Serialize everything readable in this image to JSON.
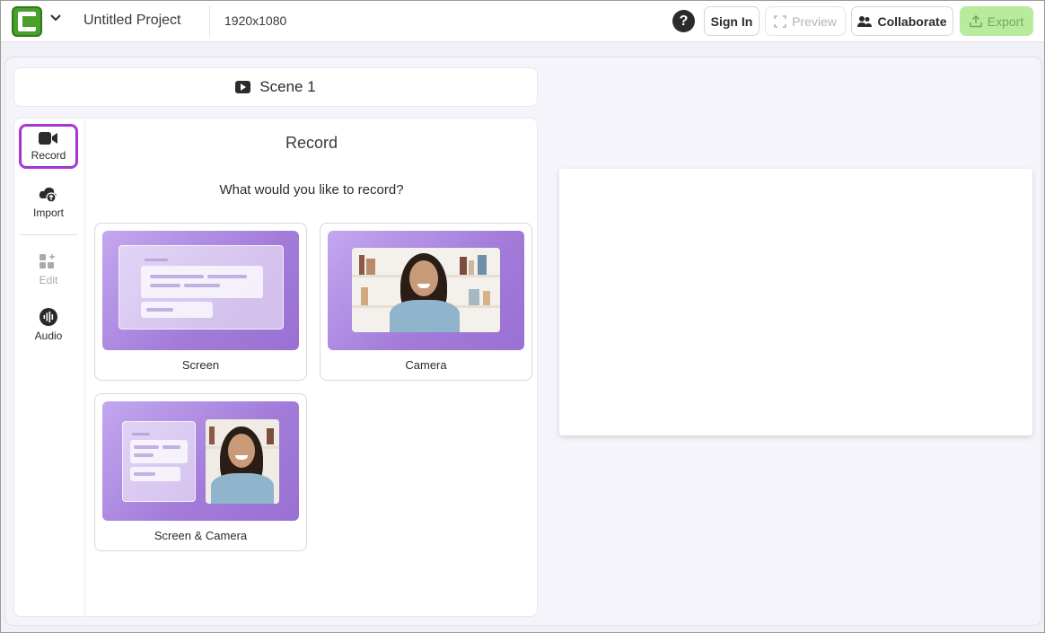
{
  "header": {
    "project_title": "Untitled Project",
    "resolution": "1920x1080",
    "help_label": "?",
    "sign_in_label": "Sign In",
    "preview_label": "Preview",
    "collaborate_label": "Collaborate",
    "export_label": "Export"
  },
  "scene": {
    "label": "Scene 1"
  },
  "tools": [
    {
      "label": "Record",
      "icon": "video-camera-icon",
      "active": true
    },
    {
      "label": "Import",
      "icon": "cloud-upload-icon"
    },
    {
      "label": "Edit",
      "icon": "edit-shapes-icon",
      "disabled": true
    },
    {
      "label": "Audio",
      "icon": "audio-wave-icon"
    }
  ],
  "record_panel": {
    "title": "Record",
    "question": "What would you like to record?",
    "options": [
      {
        "label": "Screen"
      },
      {
        "label": "Camera"
      },
      {
        "label": "Screen & Camera"
      }
    ]
  },
  "colors": {
    "accent_green": "#4aa02c",
    "export_bg": "#b8ec9c",
    "active_tool_border": "#c02fd1",
    "thumb_purple": "#a27bd9"
  }
}
